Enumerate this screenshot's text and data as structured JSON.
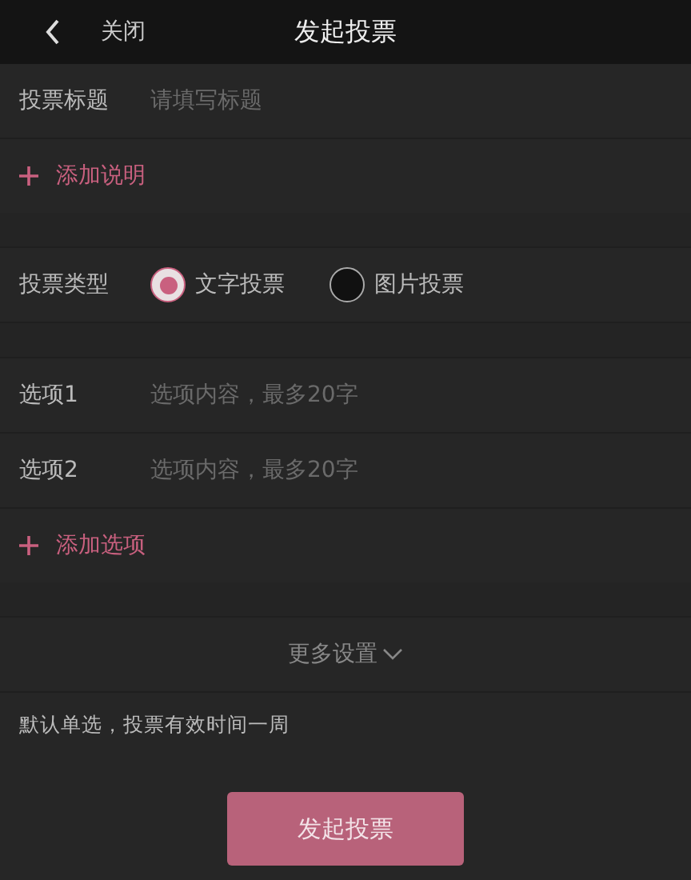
{
  "header": {
    "back_label": "关闭",
    "title": "发起投票"
  },
  "title_field": {
    "label": "投票标题",
    "placeholder": "请填写标题"
  },
  "add_description": {
    "label": "添加说明"
  },
  "vote_type": {
    "label": "投票类型",
    "options": [
      {
        "label": "文字投票",
        "selected": true
      },
      {
        "label": "图片投票",
        "selected": false
      }
    ]
  },
  "options": [
    {
      "label": "选项1",
      "placeholder": "选项内容，最多20字"
    },
    {
      "label": "选项2",
      "placeholder": "选项内容，最多20字"
    }
  ],
  "add_option": {
    "label": "添加选项"
  },
  "more_settings": {
    "label": "更多设置"
  },
  "note": "默认单选，投票有效时间一周",
  "submit": {
    "label": "发起投票"
  }
}
